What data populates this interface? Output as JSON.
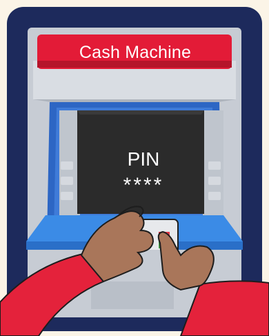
{
  "atm": {
    "sign_text": "Cash Machine",
    "screen_title": "PIN",
    "pin_masked": "****"
  },
  "colors": {
    "background": "#fbf4e7",
    "outer_panel": "#1d2a5c",
    "sign_red": "#e31b37",
    "screen_dark": "#2b2b2b",
    "frame_blue": "#2f6fd0",
    "sleeve_red": "#e4223b",
    "skin": "#a9765a"
  },
  "icons": [
    "card-reader-icon",
    "keypad-icon"
  ]
}
